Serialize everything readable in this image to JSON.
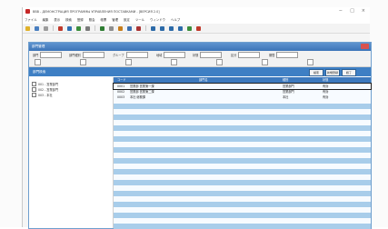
{
  "window": {
    "title": "BBB - ДЕМОНСТРАЦИЯ ПРОГРАММЫ УПРАВЛЕНИЯ ПОСТАВКАМИ - [ВЕРСИЯ 2.0]",
    "minimize_glyph": "−",
    "maximize_glyph": "□",
    "close_glyph": "×"
  },
  "menubar": {
    "items": [
      "ファイル",
      "編集",
      "表示",
      "検索",
      "登録",
      "照会",
      "帳票",
      "管理",
      "設定",
      "ツール",
      "ウィンドウ",
      "ヘルプ"
    ]
  },
  "mdi": {
    "title": "部門管理"
  },
  "criteria": {
    "fields": [
      {
        "label": "部門",
        "kind": "box"
      },
      {
        "label": "部門種別",
        "kind": "box"
      },
      {
        "label": "グループ",
        "kind": "box"
      },
      {
        "label": "地域",
        "kind": "box"
      },
      {
        "label": "状態",
        "kind": "box"
      },
      {
        "label": "区分",
        "kind": "box"
      },
      {
        "label": "期間",
        "kind": "box"
      }
    ]
  },
  "actionbar": {
    "section_title": "部門検索",
    "buttons": [
      "検索",
      "新規登録",
      "終了"
    ]
  },
  "tree": {
    "items": [
      "001 - 営業部門",
      "002 - 営業部門",
      "003 - 本社"
    ]
  },
  "grid": {
    "headers": [
      "コード",
      "部門名",
      "種別",
      "状態"
    ],
    "rows": [
      {
        "code": "0001",
        "name": "営業部 営業第一課",
        "type": "営業部門",
        "status": "有効"
      },
      {
        "code": "0002",
        "name": "営業部 営業第二課",
        "type": "営業部門",
        "status": "有効"
      },
      {
        "code": "0003",
        "name": "本社 総務課",
        "type": "本社",
        "status": "有効"
      }
    ],
    "selected_row_index": 0
  },
  "colors": {
    "accent": "#3e7fc4",
    "row_band": "#a8cdea",
    "close": "#d9534f"
  }
}
